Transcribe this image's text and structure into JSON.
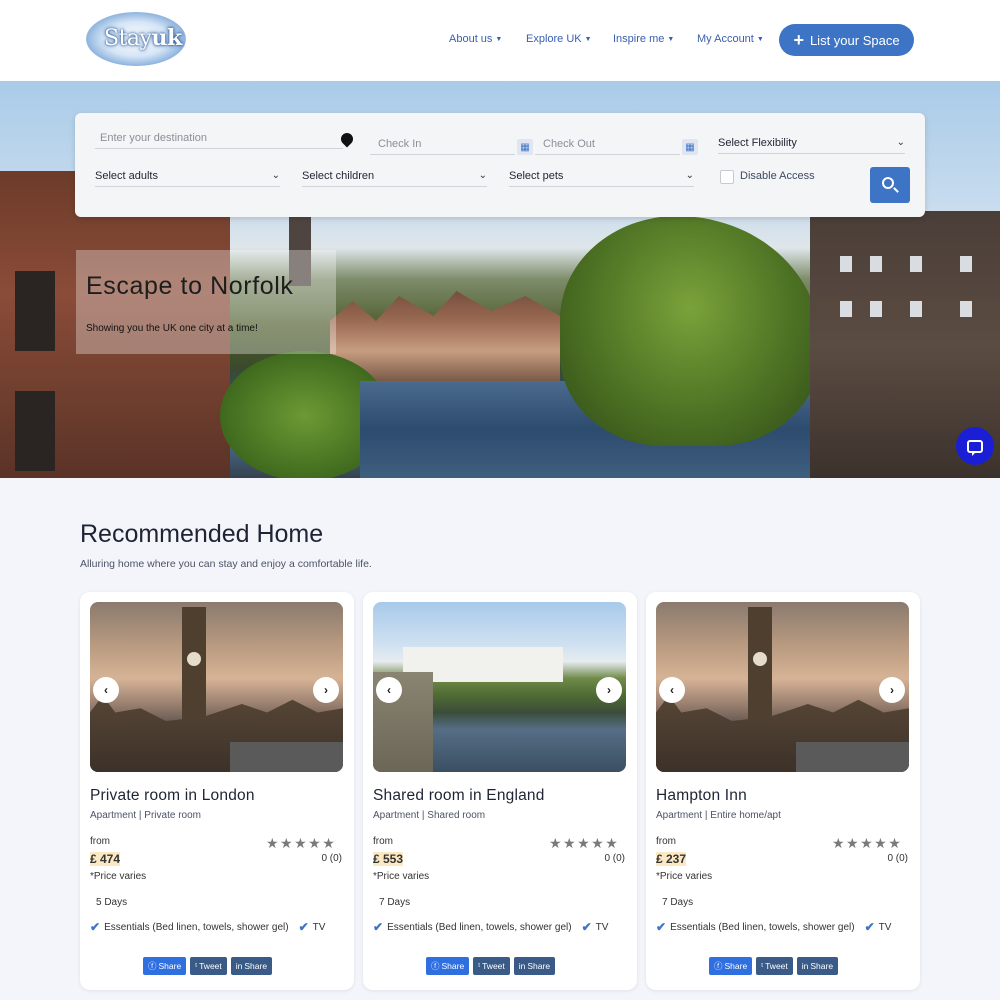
{
  "header": {
    "logo_text_stay": "Stay",
    "logo_text_uk": "uk",
    "nav": [
      "About us",
      "Explore UK",
      "Inspire me",
      "My Account"
    ],
    "list_button": "List your Space"
  },
  "search": {
    "destination_placeholder": "Enter your destination",
    "checkin_placeholder": "Check In",
    "checkout_placeholder": "Check Out",
    "flexibility": "Select Flexibility",
    "adults": "Select adults",
    "children": "Select children",
    "pets": "Select pets",
    "disable_access": "Disable Access"
  },
  "hero": {
    "title": "Escape to Norfolk",
    "subtitle": "Showing you the UK one city at a time!"
  },
  "recommended": {
    "title": "Recommended Home",
    "subtitle": "Alluring home where you can stay and enjoy a comfortable life.",
    "cards": [
      {
        "title": "Private room in London",
        "subtitle": "Apartment | Private room",
        "from": "from",
        "price": "£ 474",
        "varies": "*Price varies",
        "rating": "0 (0)",
        "days": "5 Days",
        "amenity1": "Essentials (Bed linen, towels, shower gel)",
        "amenity2": "TV",
        "image": "bigben",
        "stars": 0
      },
      {
        "title": "Shared room in England",
        "subtitle": "Apartment | Shared room",
        "from": "from",
        "price": "£ 553",
        "varies": "*Price varies",
        "rating": "0 (0)",
        "days": "7 Days",
        "amenity1": "Essentials (Bed linen, towels, shower gel)",
        "amenity2": "TV",
        "image": "river",
        "stars": 0
      },
      {
        "title": "Hampton Inn",
        "subtitle": "Apartment | Entire home/apt",
        "from": "from",
        "price": "£ 237",
        "varies": "*Price varies",
        "rating": "0 (0)",
        "days": "7 Days",
        "amenity1": "Essentials (Bed linen, towels, shower gel)",
        "amenity2": "TV",
        "image": "bigben",
        "stars": 0
      }
    ],
    "share_labels": {
      "facebook": "Share",
      "twitter": "Tweet",
      "linkedin": "Share"
    }
  },
  "colors": {
    "accent": "#3d74c5",
    "chat": "#1a1fd6"
  }
}
